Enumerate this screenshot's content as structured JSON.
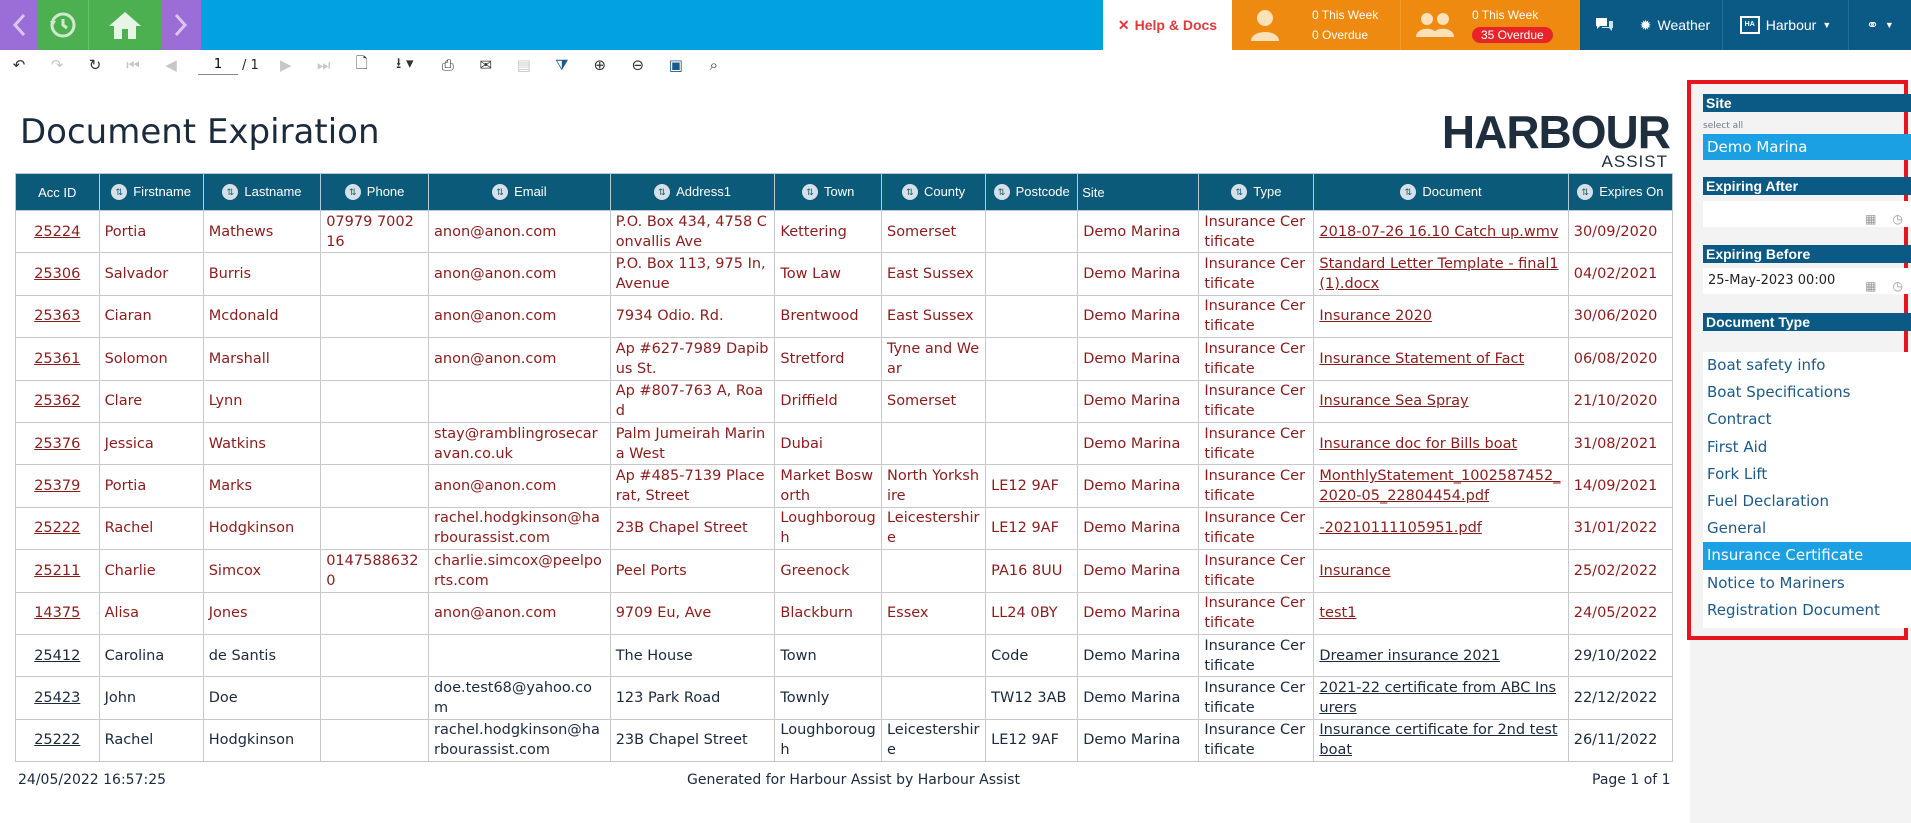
{
  "topbar": {
    "help_docs_label": "Help & Docs",
    "stat1": {
      "this_week": "0 This Week",
      "overdue": "0 Overdue"
    },
    "stat2": {
      "this_week": "0 This Week",
      "overdue": "35 Overdue"
    },
    "weather_label": "Weather",
    "harbour_label": "Harbour",
    "colors": {
      "bar": "#00a3e0",
      "purple": "#9b6dd6",
      "green": "#4cb050",
      "orange": "#ee8a10",
      "navy": "#0b5a86",
      "alert": "#e8232a"
    }
  },
  "toolbar": {
    "current_page": "1",
    "page_total": "/ 1",
    "icons": [
      "undo-icon",
      "redo-icon",
      "refresh-icon",
      "first-page-icon",
      "prev-page-icon",
      "next-page-icon",
      "last-page-icon",
      "document-icon",
      "export-icon",
      "print-icon",
      "email-icon",
      "save-icon",
      "filter-icon",
      "zoom-in-icon",
      "zoom-out-icon",
      "screen-icon",
      "search-icon"
    ]
  },
  "report": {
    "title": "Document Expiration",
    "logo_main": "HARBOUR",
    "logo_sub": "ASSIST",
    "columns": [
      "Acc ID",
      "Firstname",
      "Lastname",
      "Phone",
      "Email",
      "Address1",
      "Town",
      "County",
      "Postcode",
      "Site",
      "Type",
      "Document",
      "Expires On"
    ],
    "rows": [
      [
        "25224",
        "Portia",
        "Mathews",
        "07979 700216",
        "anon@anon.com",
        "P.O. Box 434, 4758 Convallis Ave",
        "Kettering",
        "Somerset",
        "",
        "Demo Marina",
        "Insurance Certificate",
        "2018-07-26 16.10 Catch up.wmv",
        "30/09/2020"
      ],
      [
        "25306",
        "Salvador",
        "Burris",
        "",
        "anon@anon.com",
        "P.O. Box 113, 975 In, Avenue",
        "Tow Law",
        "East Sussex",
        "",
        "Demo Marina",
        "Insurance Certificate",
        "Standard Letter Template - final1 (1).docx",
        "04/02/2021"
      ],
      [
        "25363",
        "Ciaran",
        "Mcdonald",
        "",
        "anon@anon.com",
        "7934 Odio. Rd.",
        "Brentwood",
        "East Sussex",
        "",
        "Demo Marina",
        "Insurance Certificate",
        "Insurance 2020",
        "30/06/2020"
      ],
      [
        "25361",
        "Solomon",
        "Marshall",
        "",
        "anon@anon.com",
        "Ap #627-7989 Dapibus St.",
        "Stretford",
        "Tyne and Wear",
        "",
        "Demo Marina",
        "Insurance Certificate",
        "Insurance Statement of Fact",
        "06/08/2020"
      ],
      [
        "25362",
        "Clare",
        "Lynn",
        "",
        "",
        "Ap #807-763 A, Road",
        "Driffield",
        "Somerset",
        "",
        "Demo Marina",
        "Insurance Certificate",
        "Insurance Sea Spray",
        "21/10/2020"
      ],
      [
        "25376",
        "Jessica",
        "Watkins",
        "",
        "stay@ramblingrosecaravan.co.uk",
        "Palm Jumeirah Marina West",
        "Dubai",
        "",
        "",
        "Demo Marina",
        "Insurance Certificate",
        "Insurance doc for Bills boat",
        "31/08/2021"
      ],
      [
        "25379",
        "Portia",
        "Marks",
        "",
        "anon@anon.com",
        "Ap #485-7139 Placerat, Street",
        "Market Bosworth",
        "North Yorkshire",
        "LE12 9AF",
        "Demo Marina",
        "Insurance Certificate",
        "MonthlyStatement_1002587452_2020-05_22804454.pdf",
        "14/09/2021"
      ],
      [
        "25222",
        "Rachel",
        "Hodgkinson",
        "",
        "rachel.hodgkinson@harbourassist.com",
        "23B Chapel Street",
        "Loughborough",
        "Leicestershire",
        "LE12 9AF",
        "Demo Marina",
        "Insurance Certificate",
        "-20210111105951.pdf",
        "31/01/2022"
      ],
      [
        "25211",
        "Charlie",
        "Simcox",
        "01475886320",
        "charlie.simcox@peelports.com",
        "Peel Ports",
        "Greenock",
        "",
        "PA16 8UU",
        "Demo Marina",
        "Insurance Certificate",
        "Insurance",
        "25/02/2022"
      ],
      [
        "14375",
        "Alisa",
        "Jones",
        "",
        "anon@anon.com",
        "9709 Eu, Ave",
        "Blackburn",
        "Essex",
        "LL24 0BY",
        "Demo Marina",
        "Insurance Certificate",
        "test1",
        "24/05/2022"
      ],
      [
        "25412",
        "Carolina",
        "de Santis",
        "",
        "",
        "The House",
        "Town",
        "",
        "Code",
        "Demo Marina",
        "Insurance Certificate",
        "Dreamer insurance 2021",
        "29/10/2022"
      ],
      [
        "25423",
        "John",
        "Doe",
        "",
        "doe.test68@yahoo.com",
        "123 Park Road",
        "Townly",
        "",
        "TW12 3AB",
        "Demo Marina",
        "Insurance Certificate",
        "2021-22 certificate from ABC Insurers",
        "22/12/2022"
      ],
      [
        "25222",
        "Rachel",
        "Hodgkinson",
        "",
        "rachel.hodgkinson@harbourassist.com",
        "23B Chapel Street",
        "Loughborough",
        "Leicestershire",
        "LE12 9AF",
        "Demo Marina",
        "Insurance Certificate",
        "Insurance certificate for 2nd test boat",
        "26/11/2022"
      ]
    ],
    "footer_left": "24/05/2022 16:57:25",
    "footer_mid": "Generated for Harbour Assist by Harbour Assist",
    "footer_right": "Page 1 of 1"
  },
  "params": {
    "site_title": "Site",
    "select_all": "select all",
    "site_value": "Demo Marina",
    "expiring_after_title": "Expiring After",
    "expiring_after_value": "",
    "expiring_before_title": "Expiring Before",
    "expiring_before_value": "25-May-2023 00:00",
    "doc_type_title": "Document Type",
    "doc_types": [
      "Boat safety info",
      "Boat Specifications",
      "Contract",
      "First Aid",
      "Fork Lift",
      "Fuel Declaration",
      "General",
      "Insurance Certificate",
      "Notice to Mariners",
      "Registration Document"
    ],
    "selected_doc_type": "Insurance Certificate"
  }
}
